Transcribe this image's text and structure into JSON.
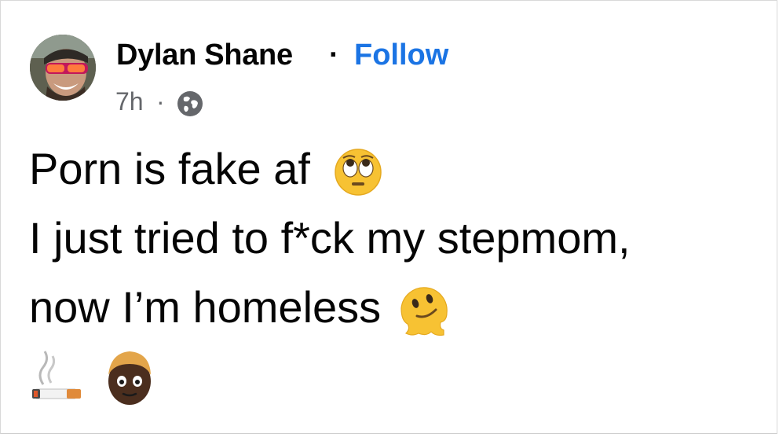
{
  "post": {
    "author_name": "Dylan Shane",
    "separator": "·",
    "follow_label": "Follow",
    "time": "7h",
    "time_separator": "·",
    "audience_icon": "globe-icon",
    "text_lines": [
      "Porn is fake af",
      "I just tried to f*ck my stepmom,",
      "now I’m homeless"
    ],
    "emojis": {
      "line1_end": "face-with-rolling-eyes",
      "line3_end": "melting-face",
      "row": [
        "cigarette",
        "man-dark-skin-tone-blond-hair"
      ]
    }
  },
  "colors": {
    "name_text": "#050505",
    "follow_link": "#1b74e4",
    "meta_text": "#65676b",
    "emoji_yellow": "#f7c233"
  }
}
